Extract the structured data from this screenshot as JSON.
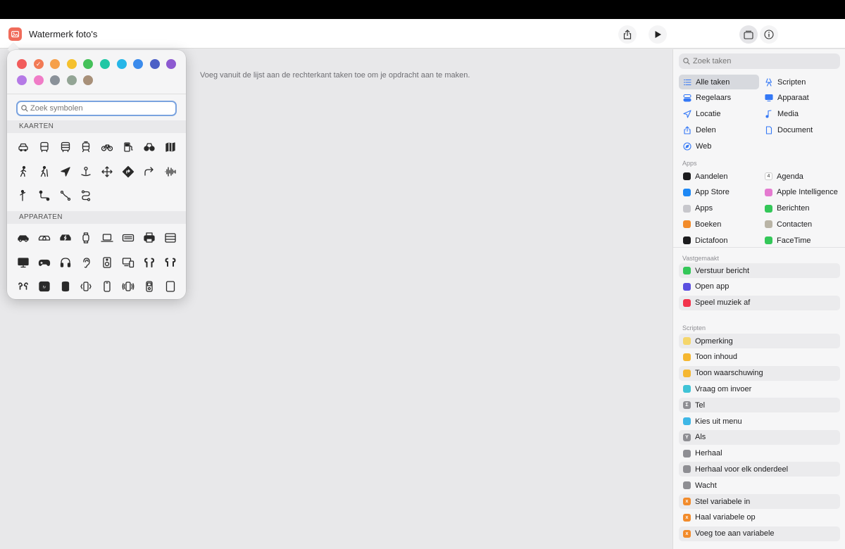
{
  "window": {
    "title": "Watermerk foto's"
  },
  "canvas": {
    "hint": "Voeg vanuit de lijst aan de rechterkant taken toe om je opdracht aan te maken."
  },
  "picker": {
    "colors": [
      "#f25c5c",
      "#f27a55",
      "#f6a04a",
      "#f5c12e",
      "#45c15a",
      "#1fc7a5",
      "#26b6e8",
      "#3b8bec",
      "#4b5fc6",
      "#8d5ad1",
      "#b57ae6",
      "#f07cc7",
      "#8a9199",
      "#93a595",
      "#a89079"
    ],
    "selected_color_index": 1,
    "search_placeholder": "Zoek symbolen",
    "sections": [
      {
        "title": "KAARTEN",
        "symbols": [
          "car",
          "bus",
          "bus-double",
          "tram",
          "bicycle",
          "fuel",
          "binoculars",
          "map",
          "walk",
          "hiker",
          "location-arrow",
          "pin-stand",
          "move-arrows",
          "directions-sign",
          "turn-right",
          "waveform",
          "person-standing",
          "route-1",
          "route-2",
          "route-loop"
        ]
      },
      {
        "title": "APPARATEN",
        "symbols": [
          "car-side",
          "cars",
          "car-bolt",
          "watch",
          "laptop",
          "keyboard",
          "printer",
          "server",
          "display",
          "gamecontroller",
          "headphones",
          "ear",
          "speaker",
          "devices",
          "airpods",
          "airpods-alt",
          "airpods-pro",
          "appletv",
          "homepod",
          "phone-vibrate",
          "phone",
          "phone-waves",
          "ipod",
          "tablet"
        ]
      }
    ]
  },
  "tasks": {
    "search_placeholder": "Zoek taken",
    "categories": [
      {
        "label": "Alle taken",
        "icon": "list-icon",
        "color": "#3478f6",
        "active": true
      },
      {
        "label": "Scripten",
        "icon": "script-icon",
        "color": "#3478f6"
      },
      {
        "label": "Regelaars",
        "icon": "toggle-icon",
        "color": "#3478f6"
      },
      {
        "label": "Apparaat",
        "icon": "monitor-icon",
        "color": "#3478f6"
      },
      {
        "label": "Locatie",
        "icon": "location-icon",
        "color": "#3478f6"
      },
      {
        "label": "Media",
        "icon": "music-note-icon",
        "color": "#3478f6"
      },
      {
        "label": "Delen",
        "icon": "share-icon",
        "color": "#3478f6"
      },
      {
        "label": "Document",
        "icon": "document-icon",
        "color": "#3478f6"
      },
      {
        "label": "Web",
        "icon": "compass-icon",
        "color": "#3478f6"
      }
    ],
    "apps_label": "Apps",
    "apps": [
      {
        "label": "Aandelen",
        "color": "#1c1c1e"
      },
      {
        "label": "Agenda",
        "color": "#ffffff",
        "badge": "4"
      },
      {
        "label": "App Store",
        "color": "#1e88f5"
      },
      {
        "label": "Apple Intelligence",
        "color": "#e47ad0"
      },
      {
        "label": "Apps",
        "color": "#c7c7cc"
      },
      {
        "label": "Berichten",
        "color": "#34c759"
      },
      {
        "label": "Boeken",
        "color": "#f28b2b"
      },
      {
        "label": "Contacten",
        "color": "#b9b4a6"
      },
      {
        "label": "Dictafoon",
        "color": "#1c1c1e"
      },
      {
        "label": "FaceTime",
        "color": "#34c759"
      }
    ],
    "pinned_label": "Vastgemaakt",
    "pinned": [
      {
        "label": "Verstuur bericht",
        "color": "#34c759",
        "icon": "message-icon"
      },
      {
        "label": "Open app",
        "color": "#5b4fe0",
        "icon": "open-arrow-icon"
      },
      {
        "label": "Speel muziek af",
        "color": "#f2334b",
        "icon": "music-icon"
      }
    ],
    "scripts_label": "Scripten",
    "scripts": [
      {
        "label": "Opmerking",
        "color": "#f5d66b",
        "icon": "lines-icon"
      },
      {
        "label": "Toon inhoud",
        "color": "#f5b731",
        "icon": "preview-icon"
      },
      {
        "label": "Toon waarschuwing",
        "color": "#f5b731",
        "icon": "alert-icon"
      },
      {
        "label": "Vraag om invoer",
        "color": "#3fc3d6",
        "icon": "input-icon"
      },
      {
        "label": "Tel",
        "color": "#8e8e93",
        "icon": "sigma-icon",
        "glyph": "Σ"
      },
      {
        "label": "Kies uit menu",
        "color": "#3fb7e6",
        "icon": "menu-icon"
      },
      {
        "label": "Als",
        "color": "#8e8e93",
        "icon": "branch-icon",
        "glyph": "Y"
      },
      {
        "label": "Herhaal",
        "color": "#8e8e93",
        "icon": "repeat-icon"
      },
      {
        "label": "Herhaal voor elk onderdeel",
        "color": "#8e8e93",
        "icon": "repeat-each-icon"
      },
      {
        "label": "Wacht",
        "color": "#8e8e93",
        "icon": "hourglass-icon"
      },
      {
        "label": "Stel variabele in",
        "color": "#f28b2b",
        "icon": "variable-icon",
        "glyph": "x"
      },
      {
        "label": "Haal variabele op",
        "color": "#f28b2b",
        "icon": "variable-icon",
        "glyph": "x"
      },
      {
        "label": "Voeg toe aan variabele",
        "color": "#f28b2b",
        "icon": "variable-icon",
        "glyph": "x"
      }
    ]
  }
}
